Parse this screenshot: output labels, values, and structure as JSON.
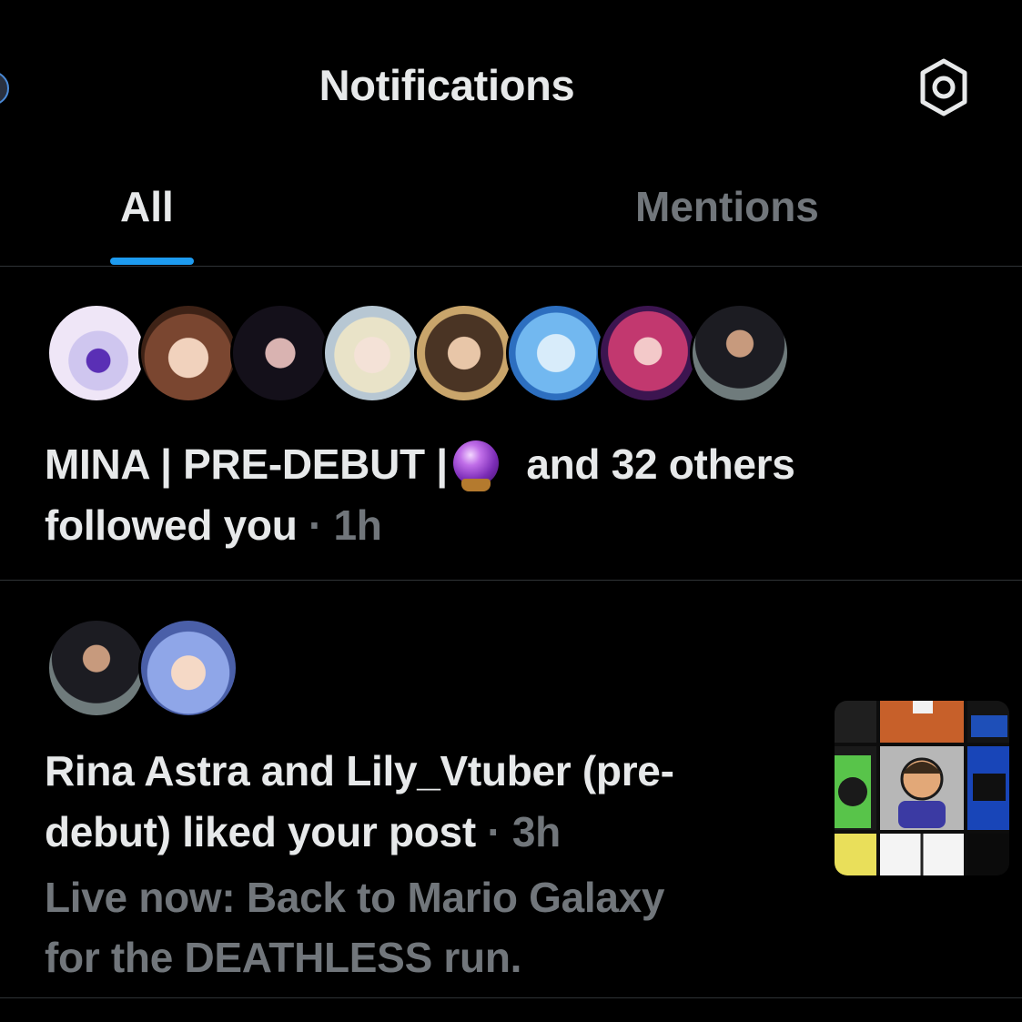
{
  "header": {
    "title": "Notifications",
    "settings_icon": "gear-icon"
  },
  "tabs": [
    {
      "label": "All",
      "active": true
    },
    {
      "label": "Mentions",
      "active": false
    }
  ],
  "colors": {
    "background": "#000000",
    "text_primary": "#e7e9ea",
    "text_secondary": "#71767b",
    "accent": "#1d9bf0",
    "divider": "#2f3336"
  },
  "notifications": [
    {
      "type": "follow",
      "avatar_count": 8,
      "actor": "MINA | PRE-DEBUT |",
      "actor_emoji": "crystal-ball-icon",
      "rest": " and 32 others",
      "action": "followed you",
      "time": " · 1h"
    },
    {
      "type": "like",
      "avatar_count": 2,
      "line1": "Rina Astra and Lily_Vtuber (pre-",
      "line2": "debut) liked your post",
      "time": " · 3h",
      "preview_line1": "Live now: Back to Mario Galaxy",
      "preview_line2": "for the DEATHLESS run.",
      "thumbnail": "post-media-thumbnail"
    }
  ]
}
